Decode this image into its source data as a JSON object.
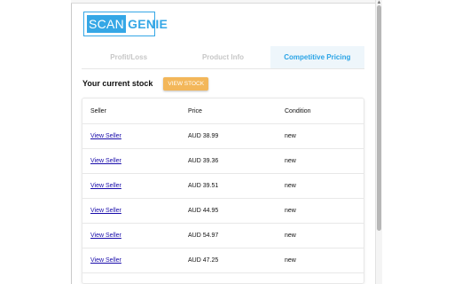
{
  "logo": {
    "part1": "SCAN",
    "part2": "GENIE"
  },
  "tabs": [
    {
      "label": "Profit/Loss",
      "active": false
    },
    {
      "label": "Product Info",
      "active": false
    },
    {
      "label": "Competitive Pricing",
      "active": true
    }
  ],
  "stock": {
    "label": "Your current stock",
    "button": "VIEW STOCK"
  },
  "table": {
    "headers": {
      "seller": "Seller",
      "price": "Price",
      "condition": "Condition"
    },
    "rows": [
      {
        "seller": "View Seller",
        "price": "AUD 38.99",
        "condition": "new"
      },
      {
        "seller": "View Seller",
        "price": "AUD 39.36",
        "condition": "new"
      },
      {
        "seller": "View Seller",
        "price": "AUD 39.51",
        "condition": "new"
      },
      {
        "seller": "View Seller",
        "price": "AUD 44.95",
        "condition": "new"
      },
      {
        "seller": "View Seller",
        "price": "AUD 54.97",
        "condition": "new"
      },
      {
        "seller": "View Seller",
        "price": "AUD 47.25",
        "condition": "new"
      }
    ]
  },
  "colors": {
    "accent": "#35a7e6",
    "button": "#f3b75a",
    "link": "#1a0dab"
  }
}
